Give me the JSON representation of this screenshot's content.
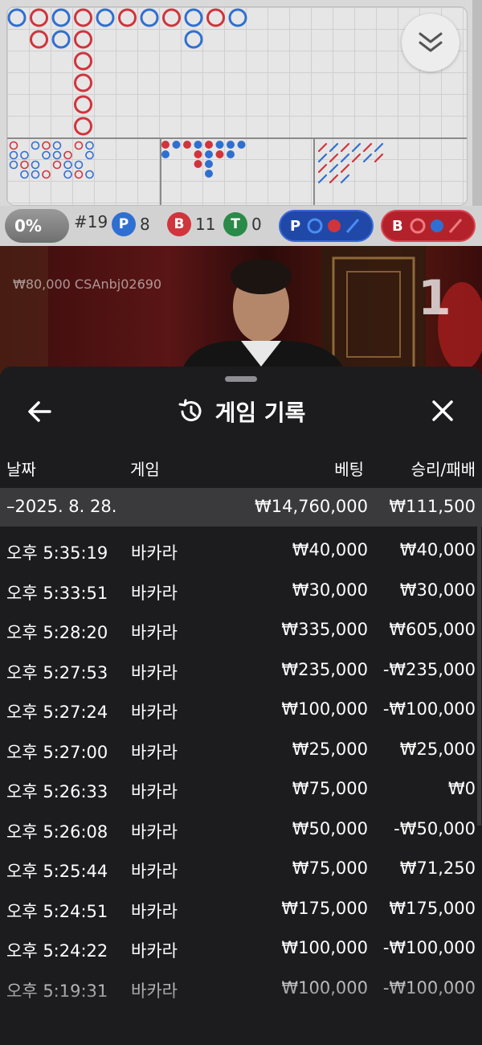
{
  "scoreboard": {
    "stats": {
      "percent": "0%",
      "round": "#19",
      "player": {
        "letter": "P",
        "count": "8"
      },
      "banker": {
        "letter": "B",
        "count": "11"
      },
      "tie": {
        "letter": "T",
        "count": "0"
      }
    },
    "predict_player": {
      "letter": "P"
    },
    "predict_banker": {
      "letter": "B"
    },
    "colors": {
      "player": "#2f6fd1",
      "banker": "#d0343c",
      "tie": "#2a8a48"
    }
  },
  "video": {
    "player_label": "₩80,000  CSAnbj02690",
    "round_number": "1"
  },
  "history": {
    "title": "게임 기록",
    "columns": {
      "date": "날짜",
      "game": "게임",
      "bet": "베팅",
      "result": "승리/패배"
    },
    "date_group": {
      "date": "–2025. 8. 28.",
      "bet": "₩14,760,000",
      "result": "₩111,500"
    },
    "rows": [
      {
        "time": "오후 5:35:19",
        "game": "바카라",
        "bet": "₩40,000",
        "result": "₩40,000"
      },
      {
        "time": "오후 5:33:51",
        "game": "바카라",
        "bet": "₩30,000",
        "result": "₩30,000"
      },
      {
        "time": "오후 5:28:20",
        "game": "바카라",
        "bet": "₩335,000",
        "result": "₩605,000"
      },
      {
        "time": "오후 5:27:53",
        "game": "바카라",
        "bet": "₩235,000",
        "result": "-₩235,000"
      },
      {
        "time": "오후 5:27:24",
        "game": "바카라",
        "bet": "₩100,000",
        "result": "-₩100,000"
      },
      {
        "time": "오후 5:27:00",
        "game": "바카라",
        "bet": "₩25,000",
        "result": "₩25,000"
      },
      {
        "time": "오후 5:26:33",
        "game": "바카라",
        "bet": "₩75,000",
        "result": "₩0"
      },
      {
        "time": "오후 5:26:08",
        "game": "바카라",
        "bet": "₩50,000",
        "result": "-₩50,000"
      },
      {
        "time": "오후 5:25:44",
        "game": "바카라",
        "bet": "₩75,000",
        "result": "₩71,250"
      },
      {
        "time": "오후 5:24:51",
        "game": "바카라",
        "bet": "₩175,000",
        "result": "₩175,000"
      },
      {
        "time": "오후 5:24:22",
        "game": "바카라",
        "bet": "₩100,000",
        "result": "-₩100,000"
      },
      {
        "time": "오후 5:19:31",
        "game": "바카라",
        "bet": "₩100,000",
        "result": "-₩100,000"
      }
    ]
  }
}
